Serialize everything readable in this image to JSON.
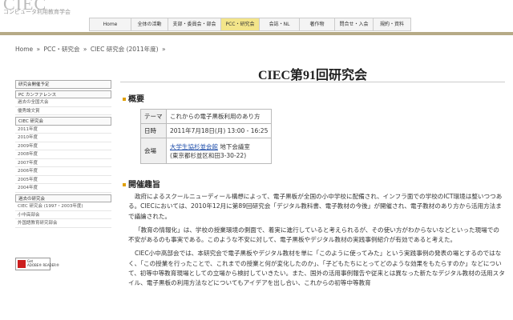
{
  "header": {
    "logo": "CIEC",
    "logo_sub": "コンピュータ利用教育学会",
    "nav": [
      {
        "label": "Home",
        "active": false
      },
      {
        "label": "全体の活動",
        "active": false
      },
      {
        "label": "支部・委員会・部会",
        "active": false
      },
      {
        "label": "PCC・研究会",
        "active": true
      },
      {
        "label": "会誌・NL",
        "active": false
      },
      {
        "label": "著作物",
        "active": false
      },
      {
        "label": "問合せ・入会",
        "active": false
      },
      {
        "label": "規約・資料",
        "active": false
      }
    ]
  },
  "breadcrumb": [
    "Home",
    "»",
    "PCC・研究会",
    "»",
    "CIEC 研究会 (2011年度)",
    "»"
  ],
  "sidebar": {
    "items": [
      {
        "label": "研究会開催予定",
        "head": true
      },
      {
        "label": "PC カンファレンス",
        "head": true
      },
      {
        "label": "過去の全国大会",
        "head": false
      },
      {
        "label": "優秀論文賞",
        "head": false
      },
      {
        "label": "CIEC 研究会",
        "head": true
      },
      {
        "label": "2011年度",
        "head": false
      },
      {
        "label": "2010年度",
        "head": false
      },
      {
        "label": "2009年度",
        "head": false
      },
      {
        "label": "2008年度",
        "head": false
      },
      {
        "label": "2007年度",
        "head": false
      },
      {
        "label": "2006年度",
        "head": false
      },
      {
        "label": "2005年度",
        "head": false
      },
      {
        "label": "2004年度",
        "head": false
      },
      {
        "label": "過去の研究会",
        "head": true
      },
      {
        "label": "CIEC 研究会 (1997・2003年度)",
        "head": false
      },
      {
        "label": "小中高部会",
        "head": false
      },
      {
        "label": "外国語教育研究部会",
        "head": false
      }
    ],
    "adobe_badge": {
      "line1": "Get",
      "line2": "ADOBE® READER®"
    }
  },
  "main": {
    "title": "CIEC第91回研究会",
    "overview_heading": "概要",
    "overview": {
      "theme_key": "テーマ",
      "theme_value": "これからの電子黒板利用のあり方",
      "date_key": "日時",
      "date_value": "2011年7月18日(月) 13:00 - 16:25",
      "venue_key": "会場",
      "venue_link": "大学生協杉並会館",
      "venue_room": " 地下会議室",
      "venue_address": "(東京都杉並区和田3-30-22)"
    },
    "purpose_heading": "開催趣旨",
    "paragraphs": [
      "政府によるスクールニューディール構想によって、電子黒板が全国の小中学校に配備され、インフラ面での学校のICT環境は整いつつある。CIECにおいては、2010年12月に第89回研究会「デジタル教科書、電子教材の今後」が開催され、電子教材のあり方から活用方法まで議論された。",
      "「教育の情報化」は、学校の授業環境の側面で、着実に進行していると考えられるが、その使い方がわからないなどといった現場での不安があるのも事実である。このような不安に対して、電子黒板やデジタル教材の実践事例紹介が有効であると考えた。",
      "CIEC小中高部会では、本研究会で電子黒板やデジタル教材を単に「このように使ってみた」という実践事例の発表の場とするのではなく、「この授業を行ったことで、これまでの授業と何が変化したのか」、「子どもたちにとってどのような効果をもたらすのか」などについて、初等中等教育現場としての立場から検討していきたい。また、国外の活用事例報告や従来とは異なった新たなデジタル教材の活用スタイル、電子黒板の利用方法などについてもアイデアを出し合い、これからの初等中等教育"
    ]
  },
  "colors": {
    "header_rule": "#b6aa86",
    "nav_active": "#f3e58a",
    "bullet": "#e0a000",
    "link": "#1a4aa8"
  }
}
